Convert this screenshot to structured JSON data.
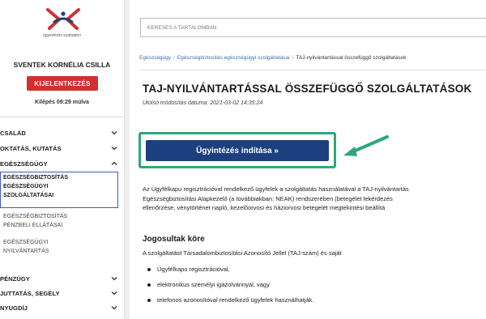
{
  "logo": {
    "text": "ügyintézés szabadon",
    "colors": {
      "primary": "#d32f2f",
      "secondary": "#1c3f7f"
    }
  },
  "user": {
    "name": "SVENTEK KORNÉLIA CSILLA",
    "logout_label": "KIJELENTKEZÉS",
    "logout_timer": "Kilépés 09:29 múlva"
  },
  "nav": {
    "items": [
      {
        "label": "CSALÁD",
        "icon": "chevron-down-icon"
      },
      {
        "label": "OKTATÁS, KUTATÁS",
        "icon": "chevron-down-icon"
      },
      {
        "label": "EGÉSZSÉGÜGY",
        "icon": "chevron-up-icon"
      },
      {
        "label": "PÉNZÜGY",
        "icon": "chevron-down-icon"
      },
      {
        "label": "JUTTATÁS, SEGÉLY",
        "icon": "chevron-down-icon"
      },
      {
        "label": "NYUGDÍJ",
        "icon": "chevron-down-icon"
      }
    ],
    "subitems": [
      {
        "lines": [
          "EGÉSZSÉGBIZTOSÍTÁS",
          "EGÉSZSÉGÜGYI",
          "SZOLGÁLTATÁSAI"
        ],
        "active": true
      },
      {
        "lines": [
          "EGÉSZSÉGBIZTOSÍTÁS",
          "PÉNZBELI ELLÁTÁSAI"
        ],
        "active": false
      },
      {
        "lines": [
          "EGÉSZSÉGÜGYI",
          "NYILVÁNTARTÁS"
        ],
        "active": false
      }
    ]
  },
  "search": {
    "placeholder": "KERESÉS A TARTALOMBAN"
  },
  "breadcrumb": {
    "items": [
      "Egészségügy",
      "Egészségbiztosítás egészségügyi szolgáltatásai",
      "TAJ-nyilvántartással összefüggő szolgáltatások"
    ],
    "separator": "/"
  },
  "page": {
    "title": "TAJ-NYILVÁNTARTÁSSAL ÖSSZEFÜGGŐ SZOLGÁLTATÁSOK",
    "modified": "Utolsó módosítás dátuma: 2021-03-02 14:35:24",
    "start_button": "Ügyintézés indítása »",
    "paragraph": [
      "Az Ügyfélkapu regisztrációval rendelkező ügyfelek a szolgáltatás használatával a TAJ-nyilvántartás",
      "Egészségbiztosítási Alapkezelő (a továbbiakban: NEAK) rendszerében (betegélet lekérdezés",
      "ellenőrzése, vénytörténet napló, kezelőorvosi és háziorvosi betegelét megtekintési beállítá"
    ],
    "section_title": "Jogosultak köre",
    "section_text": "A szolgáltatást Társadalombiztosítási Azonosító Jellel (TAJ-szám) és saját",
    "bullets": [
      "Ügyfélkapu regisztrációval,",
      "elektronikus személyi igazolvánnyal, vagy",
      "telefonos azonosítóval rendelkező ügyfelek használhatják."
    ]
  },
  "colors": {
    "accent_red": "#d32f2f",
    "button_blue": "#1c3f7f",
    "highlight_green": "#2fa779",
    "link_blue": "#3b6fb6",
    "active_border": "#3f5cc0"
  }
}
